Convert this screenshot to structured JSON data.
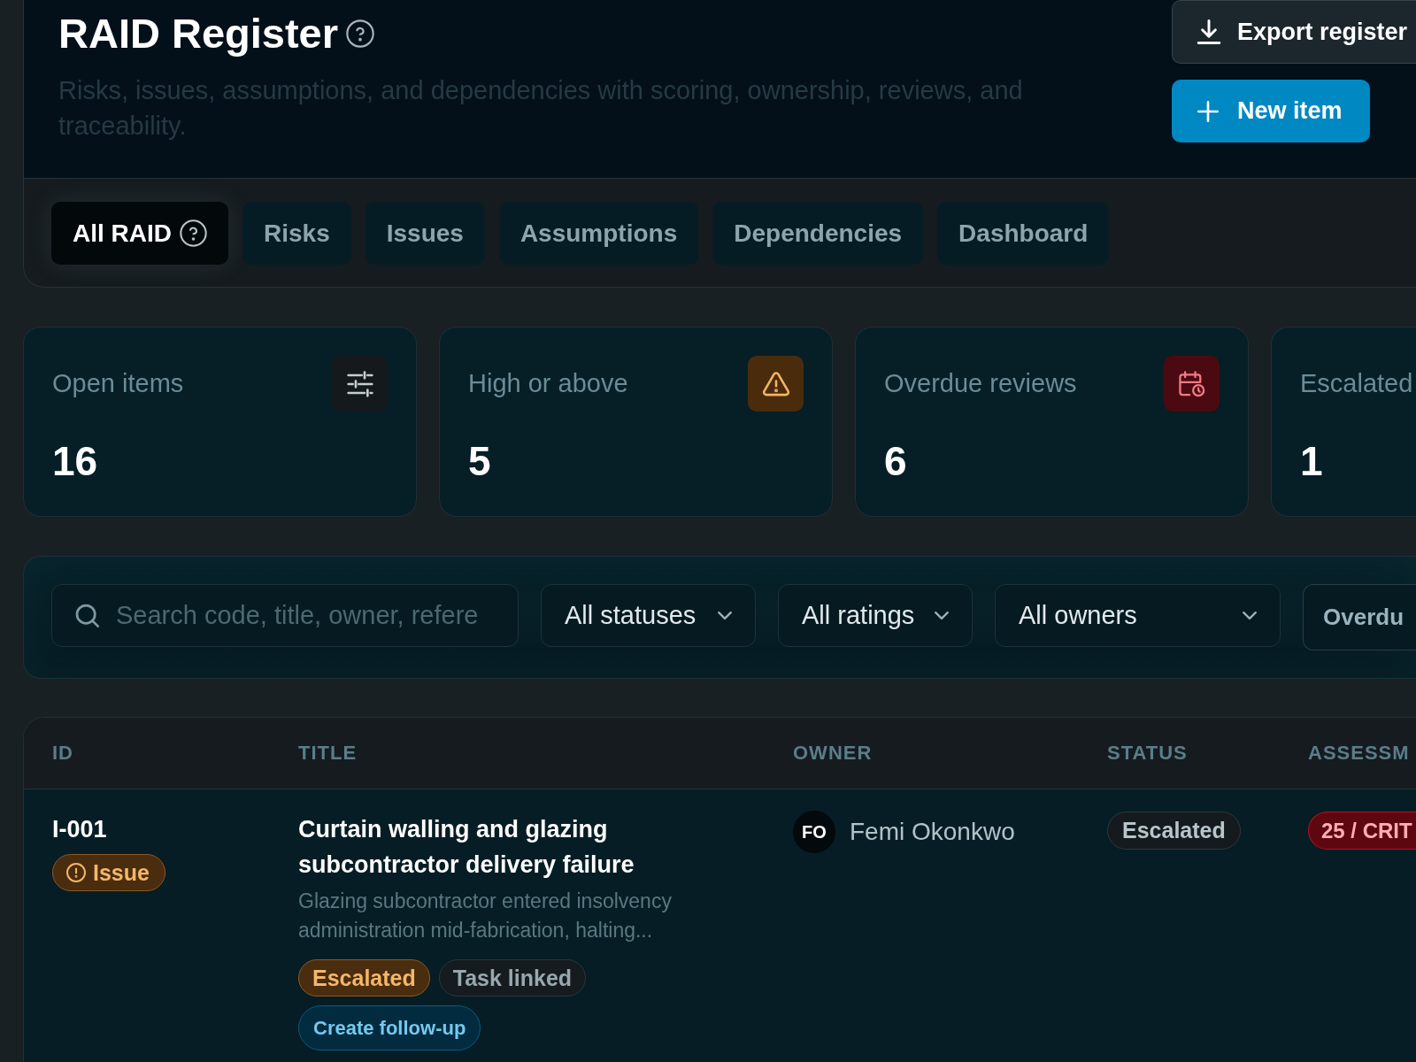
{
  "header": {
    "title": "RAID Register",
    "subtitle": "Risks, issues, assumptions, and dependencies with scoring, ownership, reviews, and traceability.",
    "actions": [
      {
        "kind": "export",
        "label": "Export register"
      },
      {
        "kind": "create",
        "label": "New item"
      }
    ]
  },
  "tabs": [
    {
      "label": "All RAID",
      "selected": true,
      "help": true
    },
    {
      "label": "Risks",
      "selected": false,
      "help": false
    },
    {
      "label": "Issues",
      "selected": false,
      "help": false
    },
    {
      "label": "Assumptions",
      "selected": false,
      "help": false
    },
    {
      "label": "Dependencies",
      "selected": false,
      "help": false
    },
    {
      "label": "Dashboard",
      "selected": false,
      "help": false
    }
  ],
  "stats": [
    {
      "label": "Open items",
      "value": "16",
      "kind": "filters"
    },
    {
      "label": "High or above",
      "value": "5",
      "kind": "warning"
    },
    {
      "label": "Overdue reviews",
      "value": "6",
      "kind": "overdue"
    },
    {
      "label": "Escalated",
      "value": "1"
    }
  ],
  "filters": {
    "search": {
      "placeholder": "Search code, title, owner, refere"
    },
    "dropdowns": [
      {
        "value": "All statuses"
      },
      {
        "value": "All ratings"
      },
      {
        "value": "All owners"
      }
    ],
    "toggle": {
      "label": "Overdu"
    }
  },
  "table": {
    "columns": [
      "ID",
      "TITLE",
      "OWNER",
      "STATUS",
      "ASSESSM"
    ],
    "rows": [
      {
        "id": "I-001",
        "type": {
          "kind": "issue",
          "label": "Issue"
        },
        "title": "Curtain walling and glazing subcontractor delivery failure",
        "description": "Glazing subcontractor entered insolvency administration mid-fabrication, halting...",
        "tags": [
          {
            "kind": "warning",
            "label": "Escalated"
          },
          {
            "kind": "neutral",
            "label": "Task linked"
          }
        ],
        "action": "Create follow-up",
        "owner": {
          "initials": "FO",
          "name": "Femi Okonkwo"
        },
        "status": "Escalated",
        "assessment": {
          "kind": "critical",
          "label": "25 / CRIT"
        }
      }
    ]
  }
}
